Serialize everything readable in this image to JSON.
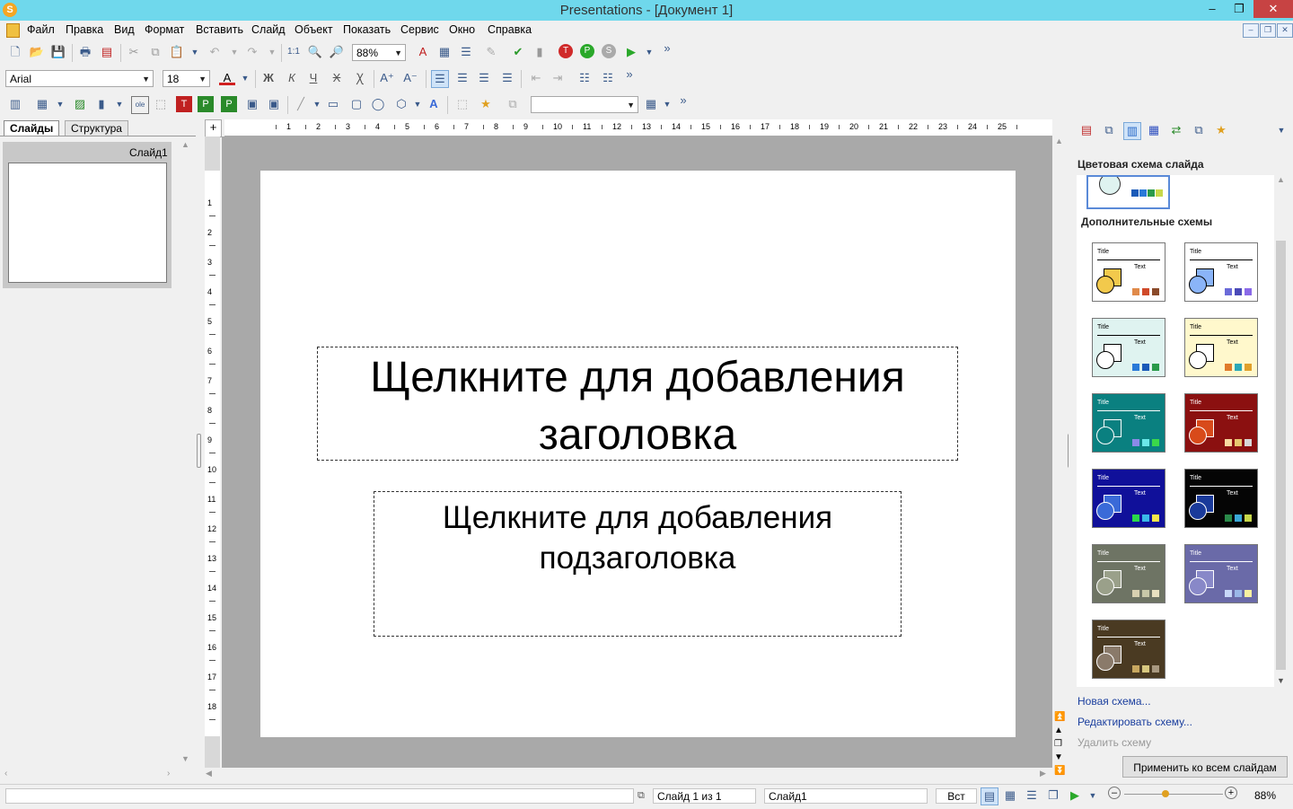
{
  "window": {
    "title": "Presentations - [Документ 1]",
    "minimize": "–",
    "restore": "❐",
    "close": "✕"
  },
  "menu": [
    "Файл",
    "Правка",
    "Вид",
    "Формат",
    "Вставить",
    "Слайд",
    "Объект",
    "Показать",
    "Сервис",
    "Окно",
    "Справка"
  ],
  "toolbar": {
    "zoom": "88%",
    "font_name": "Arial",
    "font_size": "18",
    "more": "»"
  },
  "left_pane": {
    "tabs": [
      "Слайды",
      "Структура"
    ],
    "slide_label": "Слайд1"
  },
  "slide": {
    "title_placeholder": "Щелкните для добавления заголовка",
    "subtitle_placeholder": "Щелкните для добавления подзаголовка"
  },
  "ruler": {
    "top_ticks": [
      "1",
      "2",
      "3",
      "4",
      "5",
      "6",
      "7",
      "8",
      "9",
      "10",
      "11",
      "12",
      "13",
      "14",
      "15",
      "16",
      "17",
      "18",
      "19",
      "20",
      "21",
      "22",
      "23",
      "24",
      "25"
    ],
    "left_ticks": [
      "1",
      "2",
      "3",
      "4",
      "5",
      "6",
      "7",
      "8",
      "9",
      "10",
      "11",
      "12",
      "13",
      "14",
      "15",
      "16",
      "17",
      "18"
    ]
  },
  "right_pane": {
    "heading": "Цветовая схема слайда",
    "extra_heading": "Дополнительные схемы",
    "scheme_title": "Title",
    "scheme_text": "Text",
    "schemes": [
      {
        "bg": "#ffffff",
        "fg": "#000000",
        "shape": "#f2c94c",
        "sw": [
          "#e08a4a",
          "#d04a2a",
          "#8a4a2a"
        ]
      },
      {
        "bg": "#ffffff",
        "fg": "#000000",
        "shape": "#8ab4f8",
        "sw": [
          "#6a6ad8",
          "#4a4ab8",
          "#8a6ae8"
        ]
      },
      {
        "bg": "#dff3f0",
        "fg": "#000000",
        "shape": "#ffffff",
        "sw": [
          "#2a7ad8",
          "#1a5ab8",
          "#2a9a4a"
        ]
      },
      {
        "bg": "#fff8cc",
        "fg": "#000000",
        "shape": "#ffffff",
        "sw": [
          "#e07a2a",
          "#2aa8b8",
          "#e0a02a"
        ]
      },
      {
        "bg": "#0a8080",
        "fg": "#ffffff",
        "shape": "#0a8080",
        "sw": [
          "#8a8ae8",
          "#6ae8e8",
          "#3ad84a"
        ]
      },
      {
        "bg": "#8b1010",
        "fg": "#ffffff",
        "shape": "#d84a1a",
        "sw": [
          "#f8d8a0",
          "#e8c870",
          "#d8d8d8"
        ]
      },
      {
        "bg": "#10109a",
        "fg": "#ffffff",
        "shape": "#3a6ad8",
        "sw": [
          "#2ad84a",
          "#3ab8e8",
          "#f8e84a"
        ]
      },
      {
        "bg": "#050505",
        "fg": "#ffffff",
        "shape": "#1a3a9a",
        "sw": [
          "#2a8a4a",
          "#3aa8d8",
          "#c8d84a"
        ]
      },
      {
        "bg": "#6e7464",
        "fg": "#ffffff",
        "shape": "#9aa08a",
        "sw": [
          "#d8d0b0",
          "#c8c8a8",
          "#e8e0c0"
        ]
      },
      {
        "bg": "#6a6aa8",
        "fg": "#ffffff",
        "shape": "#8888c8",
        "sw": [
          "#c8d8f8",
          "#9ab8e8",
          "#f8f0a0"
        ]
      },
      {
        "bg": "#4a3a22",
        "fg": "#ffffff",
        "shape": "#8a7a6a",
        "sw": [
          "#c8a860",
          "#d8c880",
          "#a89880"
        ]
      }
    ],
    "links": [
      "Новая схема...",
      "Редактировать схему...",
      "Удалить схему"
    ],
    "apply_button": "Применить ко всем слайдам"
  },
  "status": {
    "slide_counter": "Слайд 1 из 1",
    "slide_name": "Слайд1",
    "mode": "Вст",
    "zoom": "88%"
  }
}
